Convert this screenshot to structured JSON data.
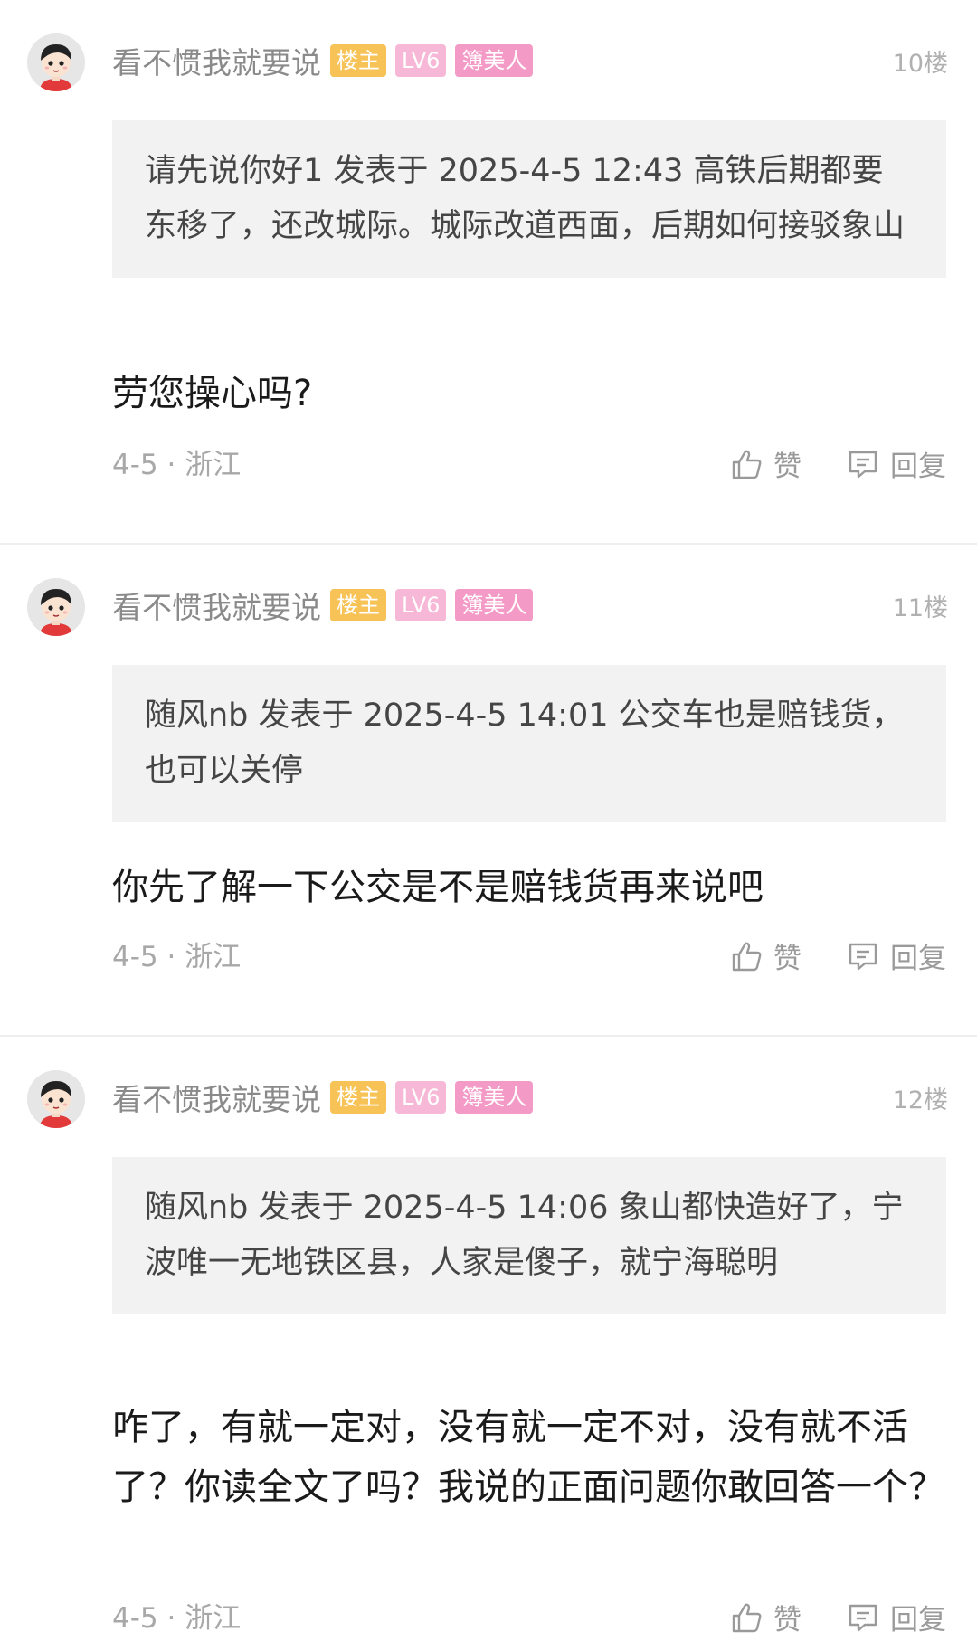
{
  "posts": [
    {
      "username": "看不惯我就要说",
      "badges": [
        "楼主",
        "LV6",
        "簿美人"
      ],
      "floor": "10楼",
      "quote": "请先说你好1 发表于 2025-4-5 12:43 高铁后期都要东移了，还改城际。城际改道西面，后期如何接驳象山",
      "content": "劳您操心吗?",
      "meta": "4-5 · 浙江",
      "like_label": "赞",
      "reply_label": "回复"
    },
    {
      "username": "看不惯我就要说",
      "badges": [
        "楼主",
        "LV6",
        "簿美人"
      ],
      "floor": "11楼",
      "quote": "随风nb 发表于 2025-4-5 14:01 公交车也是赔钱货，也可以关停",
      "content": "你先了解一下公交是不是赔钱货再来说吧",
      "meta": "4-5 · 浙江",
      "like_label": "赞",
      "reply_label": "回复"
    },
    {
      "username": "看不惯我就要说",
      "badges": [
        "楼主",
        "LV6",
        "簿美人"
      ],
      "floor": "12楼",
      "quote": "随风nb 发表于 2025-4-5 14:06 象山都快造好了，宁波唯一无地铁区县，人家是傻子，就宁海聪明",
      "content": "咋了，有就一定对，没有就一定不对，没有就不活了？你读全文了吗？我说的正面问题你敢回答一个？",
      "meta": "4-5 · 浙江",
      "like_label": "赞",
      "reply_label": "回复"
    }
  ],
  "colors": {
    "badge_owner": "#f7c256",
    "badge_level": "#f6b8d6",
    "badge_title": "#f49ac6",
    "quote_bg": "#f2f2f2"
  },
  "icons": {
    "avatar": "cartoon-boy-avatar",
    "like": "thumbs-up-icon",
    "reply": "comment-bubble-icon"
  }
}
